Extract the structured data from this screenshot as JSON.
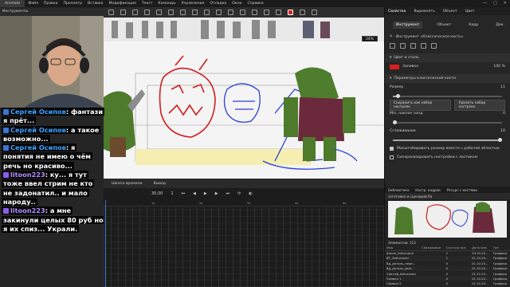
{
  "menubar": {
    "brand": "Animate",
    "items": [
      "Файл",
      "Правка",
      "Просмотр",
      "Вставка",
      "Модификация",
      "Текст",
      "Команды",
      "Управление",
      "Отладка",
      "Окно",
      "Справка"
    ],
    "window_controls": [
      "—",
      "□",
      "✕"
    ]
  },
  "tools": {
    "title": "Инструменты",
    "stroke_color": "#d62020"
  },
  "canvas": {
    "zoom": "24%"
  },
  "chat": {
    "messages": [
      {
        "user": "Сергей Осипов",
        "user_color": "#3aa0ff",
        "badge": "blue",
        "text": ": фантази я прёт..."
      },
      {
        "user": "Сергей Осипов",
        "user_color": "#3aa0ff",
        "badge": "blue",
        "text": ": а такое возможно..."
      },
      {
        "user": "Сергей Осипов",
        "user_color": "#3aa0ff",
        "badge": "blue",
        "text": ": я понятия не имею о чём речь но красиво..."
      },
      {
        "user": "litoon223",
        "user_color": "#b08cff",
        "badge": "purple",
        "text": ": ку... я тут тоже ввел стрим не кто не задонатил.. и мало народу.."
      },
      {
        "user": "litoon223",
        "user_color": "#b08cff",
        "badge": "purple",
        "text": ": а мне закинули целых 80 руб но я их спиз... Украли."
      }
    ]
  },
  "timeline": {
    "tabs": [
      "Шкала времени",
      "Вывод"
    ],
    "fps": "30,00",
    "frame": "1",
    "ruler": [
      "1s",
      "2s",
      "3s",
      "4s",
      "5s"
    ]
  },
  "properties": {
    "tabs": [
      "Свойства",
      "Выровнять",
      "Объект",
      "Цвет"
    ],
    "subtabs": [
      "Инструмент",
      "Объект",
      "Кадр",
      "Док."
    ],
    "tool_name": "Инструмент «Классическая кисть»",
    "fill_section": "Цвет и стиль",
    "fill_label": "Заливка",
    "fill_alpha": "100 %",
    "brush_section": "Параметры классической кисти",
    "size_label": "Размер",
    "size_value": "11",
    "save_preset": "Сохранить как набор настроек",
    "manage_presets": "Удалить набор настроек",
    "smoothing_label": "Min, наклон зонд.",
    "smoothing_value": "0",
    "smoothing2_label": "Сглаживание",
    "smoothing2_value": "10",
    "option1": "Масштабировать размер вместе с рабочей областью",
    "option2": "Синхронизировать настройки с ластиком"
  },
  "library": {
    "tabs": [
      "Библиотека",
      "Настр. кадров",
      "Ресурс с кистями"
    ],
    "document": "заготовка и сценарий.fla",
    "count": "Элементов: 112",
    "columns": [
      "Имя",
      "Связывание",
      "Счетчик исп.",
      "Дата изм.",
      "Тип"
    ],
    "rows": [
      [
        "Анкин_fattursand",
        "",
        "2",
        "24.10.20...",
        "Графика"
      ],
      [
        "BT_3attursand",
        "",
        "1",
        "01.10.20...",
        "Графика"
      ],
      [
        "Вд_деталь_пере...",
        "",
        "0",
        "01.10.20...",
        "Графика"
      ],
      [
        "Вд_деталь_фон...",
        "",
        "0",
        "01.10.20...",
        "Графика"
      ],
      [
        "Сивтый_fattursand",
        "",
        "0",
        "01.10.20...",
        "Графика"
      ],
      [
        "Символ 1",
        "",
        "0",
        "01.10.20...",
        "Графика"
      ],
      [
        "Символ 2",
        "",
        "0",
        "01.10.20...",
        "Графика"
      ],
      [
        "Символ 3",
        "",
        "0",
        "01.10.20...",
        "Графика"
      ],
      [
        "Символ 4",
        "",
        "0",
        "01.10.20...",
        "Графика"
      ],
      [
        "Символ 5",
        "",
        "0",
        "01.10.20...",
        "Графика"
      ]
    ]
  }
}
